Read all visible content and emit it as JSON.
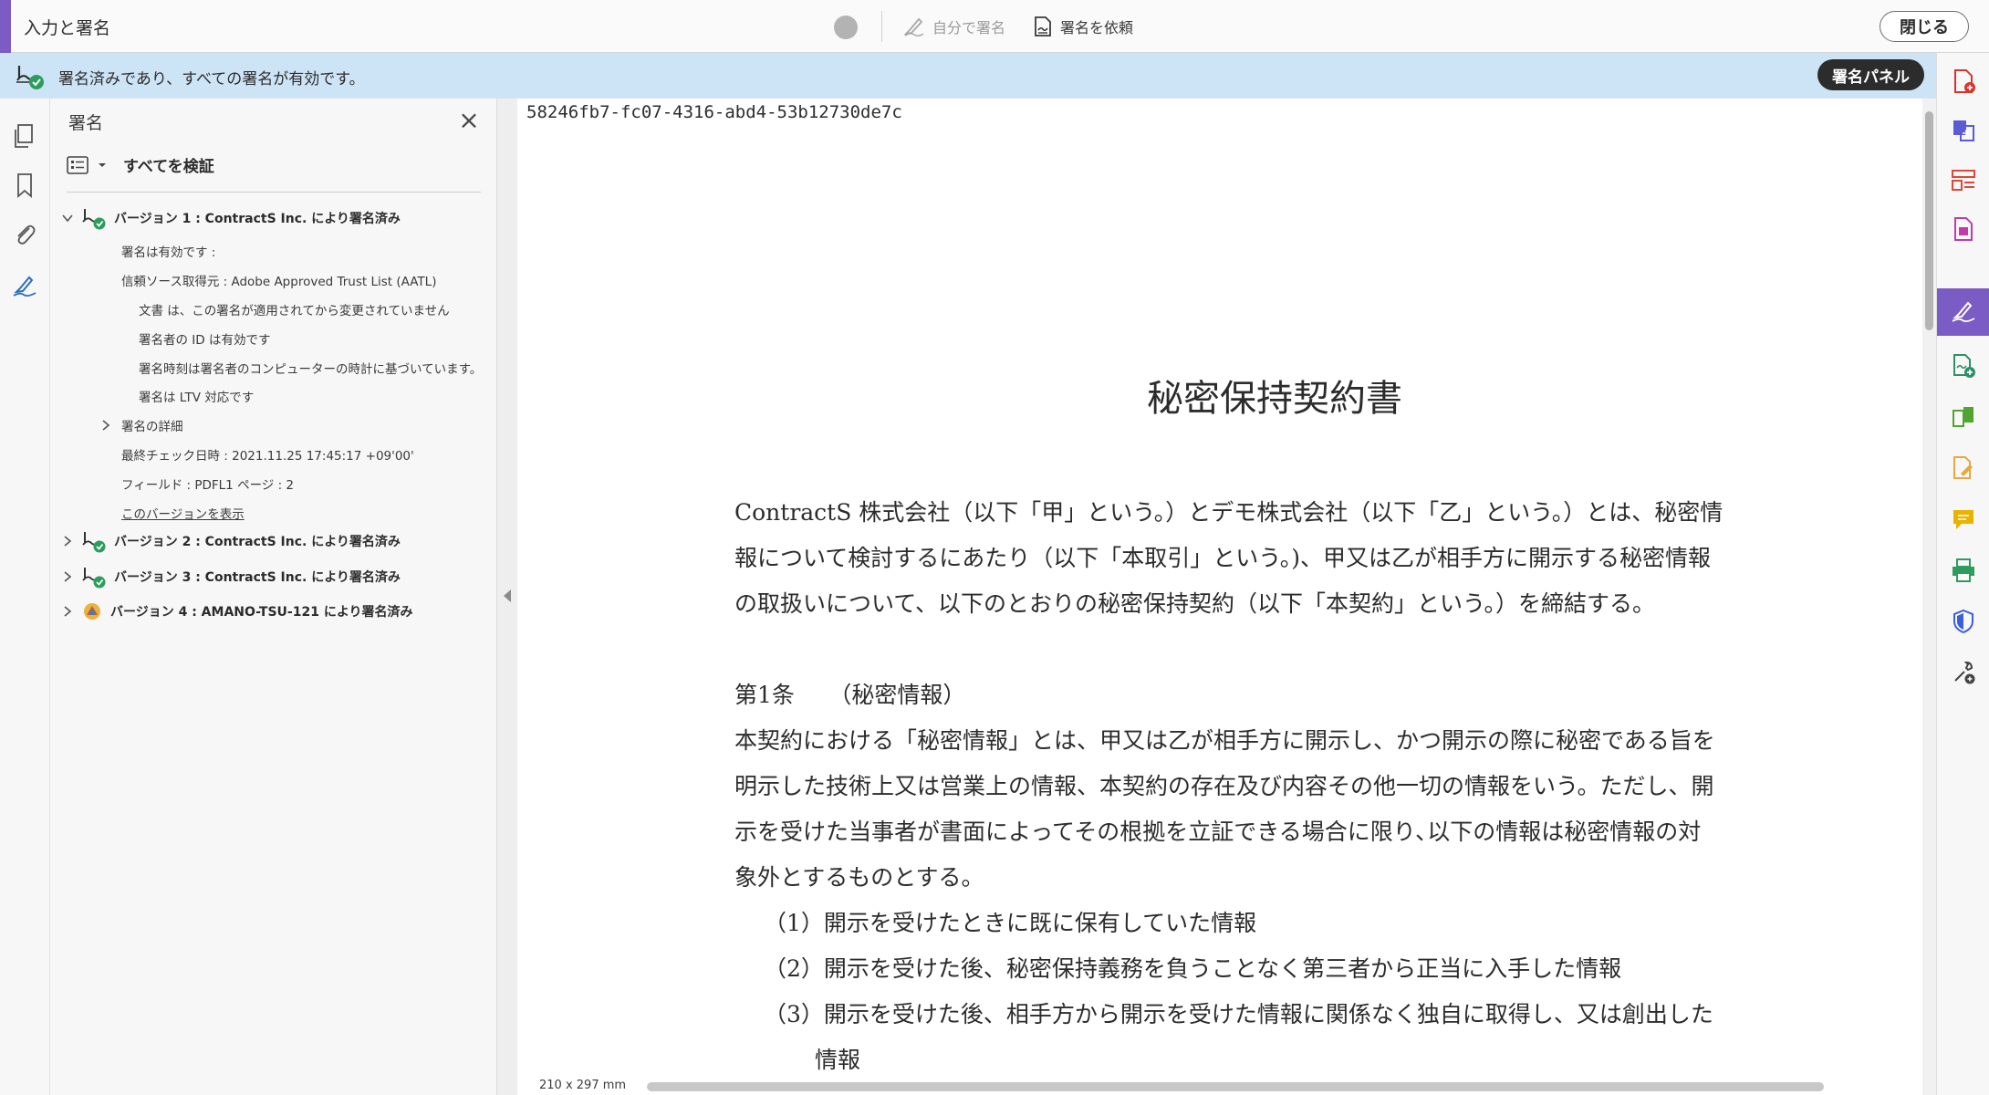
{
  "toolbar": {
    "title": "入力と署名",
    "self_sign_label": "自分で署名",
    "request_sign_label": "署名を依頼",
    "close_label": "閉じる",
    "accent_color": "#7b5cc4"
  },
  "status_bar": {
    "message": "署名済みであり、すべての署名が有効です。",
    "panel_button_label": "署名パネル",
    "background_color": "#cde3f6"
  },
  "left_rail": {
    "icons": [
      "pages-icon",
      "bookmark-icon",
      "attachment-icon",
      "signature-pen-icon"
    ]
  },
  "signature_panel": {
    "title": "署名",
    "verify_all_label": "すべてを検証",
    "version1": {
      "label": "バージョン 1 : ContractS Inc. により署名済み",
      "valid": "署名は有効です :",
      "trust_source": "信頼ソース取得元 : Adobe Approved Trust List (AATL)",
      "not_modified": "文書 は、この署名が適用されてから変更されていません",
      "identity_valid": "署名者の ID は有効です",
      "time_note": "署名時刻は署名者のコンピューターの時計に基づいています。",
      "ltv": "署名は LTV 対応です",
      "details": "署名の詳細",
      "last_checked": "最終チェック日時 : 2021.11.25 17:45:17 +09'00'",
      "field": "フィールド : PDFL1  ページ : 2",
      "show_version": "このバージョンを表示"
    },
    "version2": {
      "label": "バージョン 2 : ContractS Inc. により署名済み"
    },
    "version3": {
      "label": "バージョン 3 : ContractS Inc. により署名済み"
    },
    "version4": {
      "label": "バージョン 4 : AMANO-TSU-121 により署名済み"
    }
  },
  "document": {
    "id": "58246fb7-fc07-4316-abd4-53b12730de7c",
    "title": "秘密保持契約書",
    "intro": [
      "ContractS 株式会社（以下「甲」という。）とデモ株式会社（以下「乙」という。）とは、秘密情",
      "報について検討するにあたり（以下「本取引」という。)、甲又は乙が相手方に開示する秘密情報",
      "の取扱いについて、以下のとおりの秘密保持契約（以下「本契約」という。）を締結する。"
    ],
    "article1_heading": "第1条　　（秘密情報）",
    "article1_body": [
      "本契約における「秘密情報」とは、甲又は乙が相手方に開示し、かつ開示の際に秘密である旨を",
      "明示した技術上又は営業上の情報、本契約の存在及び内容その他一切の情報をいう。ただし、開",
      "示を受けた当事者が書面によってその根拠を立証できる場合に限り､以下の情報は秘密情報の対",
      "象外とするものとする。"
    ],
    "items": [
      "（1）開示を受けたときに既に保有していた情報",
      "（2）開示を受けた後、秘密保持義務を負うことなく第三者から正当に入手した情報",
      "（3）開示を受けた後、相手方から開示を受けた情報に関係なく独自に取得し、又は創出した"
    ],
    "item3_cont": "情報",
    "page_size": "210 x 297 mm"
  },
  "right_rail": {
    "tools": [
      "create-pdf-icon",
      "combine-files-icon",
      "organize-pages-icon",
      "export-pdf-icon",
      "fill-sign-icon",
      "request-signature-icon",
      "compare-icon",
      "edit-pdf-icon",
      "comment-icon",
      "print-production-icon",
      "protect-icon",
      "more-tools-icon"
    ]
  }
}
